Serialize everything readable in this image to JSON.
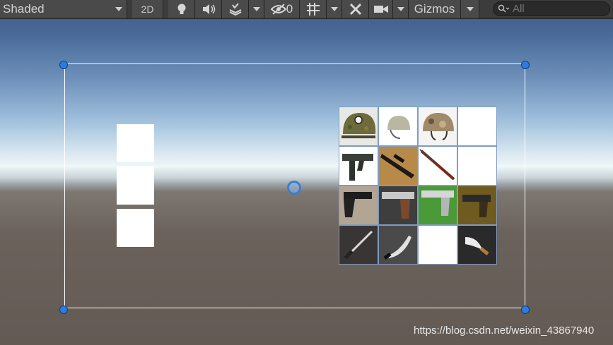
{
  "toolbar": {
    "shading_mode": "Shaded",
    "mode_2d_label": "2D",
    "effects_count": "0",
    "gizmos_label": "Gizmos",
    "search_placeholder": "All"
  },
  "inventory": {
    "left_slots": [
      "",
      "",
      ""
    ],
    "grid": [
      [
        "helmet-ssh",
        "helmet-white",
        "helmet-camo",
        ""
      ],
      [
        "smg",
        "rifle-scoped",
        "bolt-rifle",
        ""
      ],
      [
        "pistol-black",
        "pistol-silver",
        "pistol-green-bg",
        "pistol-gold-bg"
      ],
      [
        "combat-knife",
        "kukri",
        "",
        "karambit"
      ]
    ]
  },
  "watermark": "https://blog.csdn.net/weixin_43867940",
  "colors": {
    "toolbar": "#3c3c3c",
    "handle": "#2e7be0",
    "grid_gap": "#7f9cbf"
  }
}
